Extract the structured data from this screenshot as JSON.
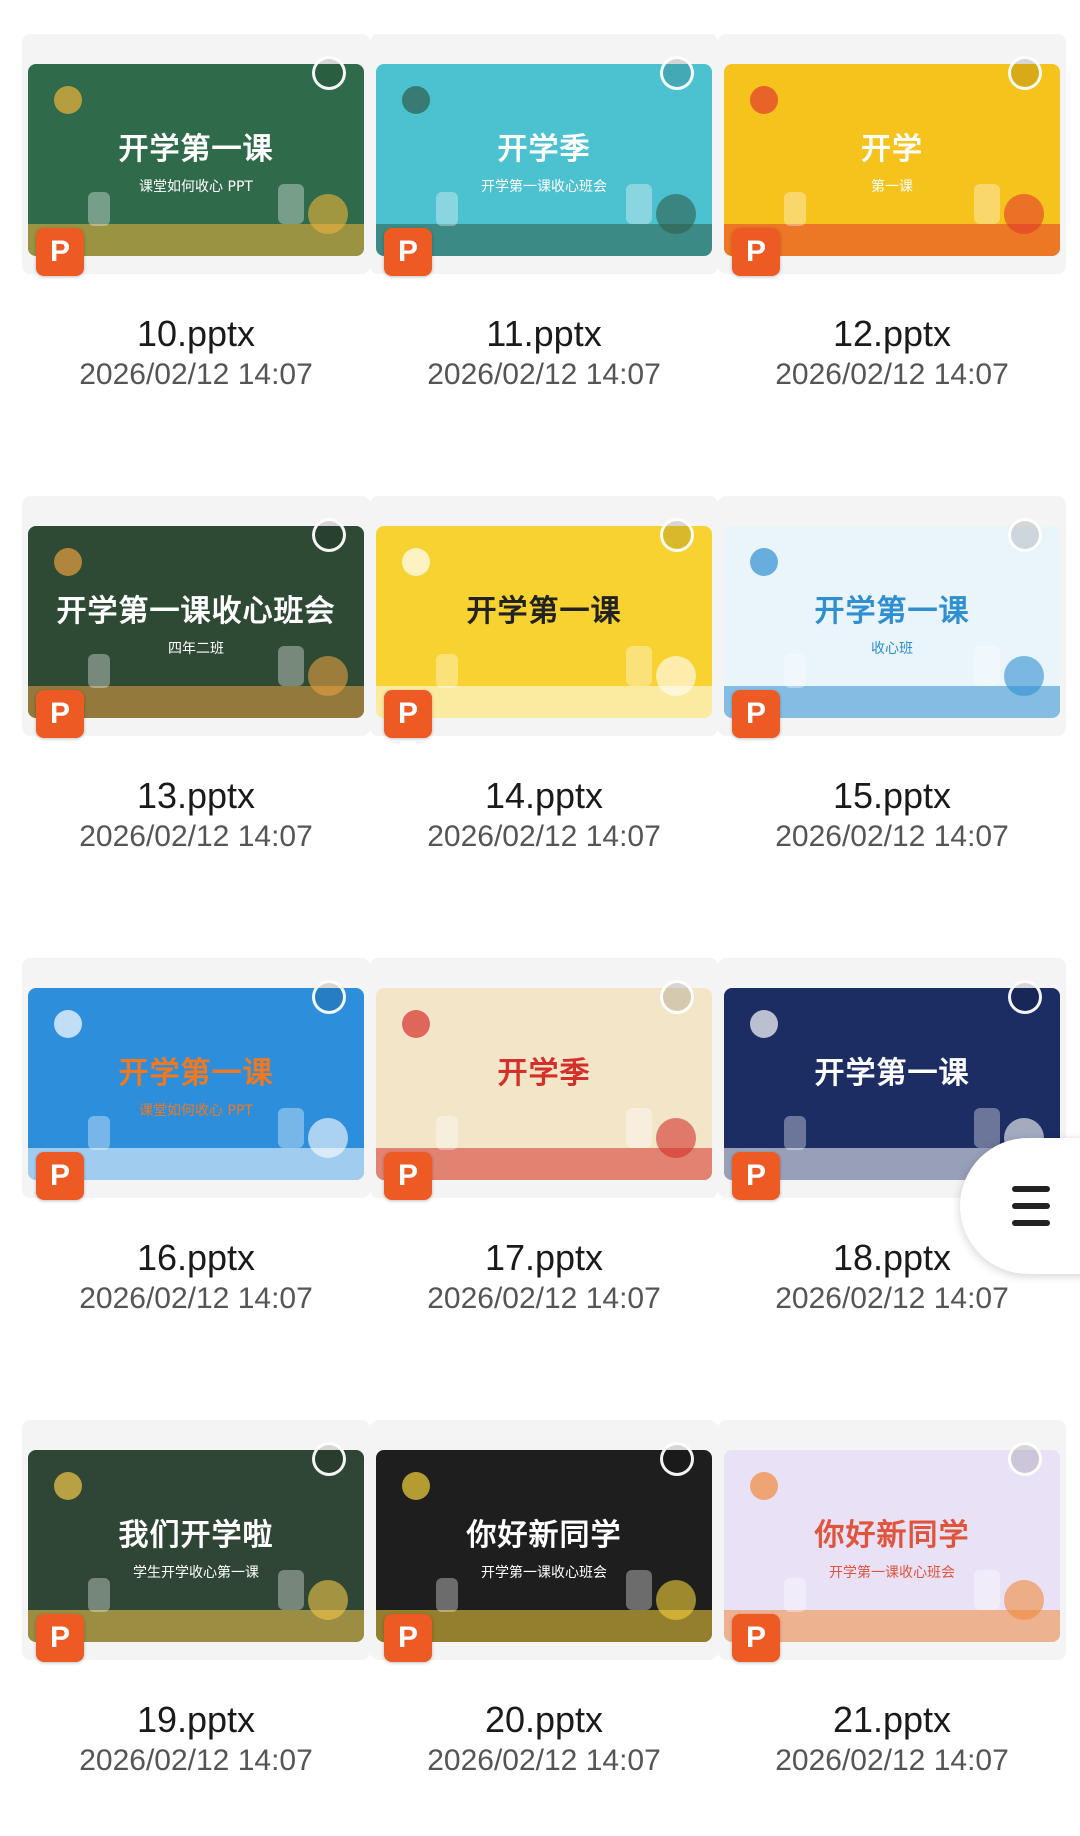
{
  "files": [
    {
      "name": "10.pptx",
      "date": "2026/02/12 14:07",
      "thumb_title": "开学第一课",
      "thumb_sub": "课堂如何收心 PPT",
      "colors": {
        "bg": "#2f6b4a",
        "accent": "#f0b43c",
        "text": "#ffffff"
      }
    },
    {
      "name": "11.pptx",
      "date": "2026/02/12 14:07",
      "thumb_title": "开学季",
      "thumb_sub": "开学第一课收心班会",
      "colors": {
        "bg": "#4cc1cf",
        "accent": "#2f5d4a",
        "text": "#ffffff"
      }
    },
    {
      "name": "12.pptx",
      "date": "2026/02/12 14:07",
      "thumb_title": "开学",
      "thumb_sub": "第一课",
      "colors": {
        "bg": "#f6c21c",
        "accent": "#e33a2c",
        "text": "#ffffff"
      }
    },
    {
      "name": "13.pptx",
      "date": "2026/02/12 14:07",
      "thumb_title": "开学第一课收心班会",
      "thumb_sub": "四年二班",
      "colors": {
        "bg": "#2e4a35",
        "accent": "#e8a040",
        "text": "#ffffff"
      }
    },
    {
      "name": "14.pptx",
      "date": "2026/02/12 14:07",
      "thumb_title": "开学第一课",
      "thumb_sub": "",
      "colors": {
        "bg": "#f7d230",
        "accent": "#ffffff",
        "text": "#222222"
      }
    },
    {
      "name": "15.pptx",
      "date": "2026/02/12 14:07",
      "thumb_title": "开学第一课",
      "thumb_sub": "收心班",
      "colors": {
        "bg": "#eaf4fb",
        "accent": "#2f8fd0",
        "text": "#2f8fd0"
      }
    },
    {
      "name": "16.pptx",
      "date": "2026/02/12 14:07",
      "thumb_title": "开学第一课",
      "thumb_sub": "课堂如何收心 PPT",
      "colors": {
        "bg": "#2d8fdc",
        "accent": "#ffffff",
        "text": "#f0781e"
      }
    },
    {
      "name": "17.pptx",
      "date": "2026/02/12 14:07",
      "thumb_title": "开学季",
      "thumb_sub": "",
      "colors": {
        "bg": "#f3e6c8",
        "accent": "#d4302a",
        "text": "#d4302a"
      }
    },
    {
      "name": "18.pptx",
      "date": "2026/02/12 14:07",
      "thumb_title": "开学第一课",
      "thumb_sub": "",
      "colors": {
        "bg": "#1c2d64",
        "accent": "#ffffff",
        "text": "#ffffff"
      }
    },
    {
      "name": "19.pptx",
      "date": "2026/02/12 14:07",
      "thumb_title": "我们开学啦",
      "thumb_sub": "学生开学收心第一课",
      "colors": {
        "bg": "#2f4535",
        "accent": "#f4c84a",
        "text": "#ffffff"
      }
    },
    {
      "name": "20.pptx",
      "date": "2026/02/12 14:07",
      "thumb_title": "你好新同学",
      "thumb_sub": "开学第一课收心班会",
      "colors": {
        "bg": "#1e1e1e",
        "accent": "#f4d03a",
        "text": "#ffffff"
      }
    },
    {
      "name": "21.pptx",
      "date": "2026/02/12 14:07",
      "thumb_title": "你好新同学",
      "thumb_sub": "开学第一课收心班会",
      "colors": {
        "bg": "#e9e2f6",
        "accent": "#f08a3c",
        "text": "#e0543c"
      }
    }
  ],
  "file_icon": {
    "label": "P",
    "color": "#ee5a24"
  },
  "menu_button": {
    "icon": "hamburger-menu-icon"
  }
}
